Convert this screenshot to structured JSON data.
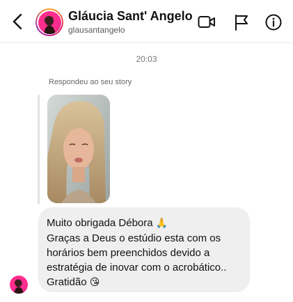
{
  "header": {
    "display_name": "Gláucia Sant' Angelo",
    "username": "glausantangelo",
    "icons": [
      "back-icon",
      "video-call-icon",
      "flag-icon",
      "info-icon"
    ]
  },
  "conversation": {
    "timestamp": "20:03",
    "story_reply_label": "Respondeu ao seu story",
    "message_lines": [
      "Muito obrigada Débora",
      "Graças a Deus o estúdio esta com os",
      "horários bem preenchidos devido a",
      "estratégia de inovar com o acrobático..",
      "Gratidão"
    ],
    "emojis": {
      "line1": "🙏",
      "line5": "😘"
    }
  },
  "colors": {
    "bubble_bg": "#efefef",
    "divider": "#ececec",
    "avatar_pink": "#ff2d8e"
  }
}
